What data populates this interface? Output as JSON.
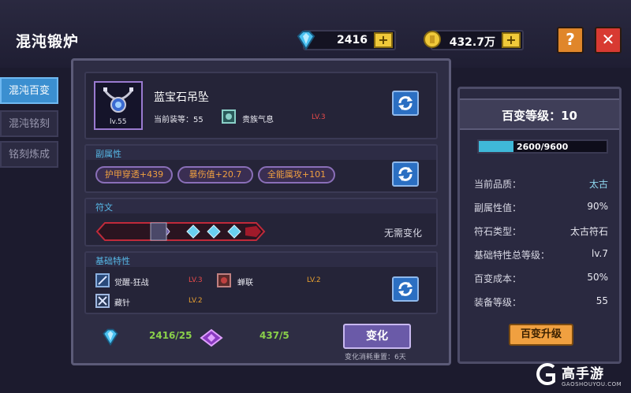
{
  "header": {
    "title": "混沌锻炉",
    "diamonds": "2416",
    "gold": "432.7万",
    "plus_label": "+",
    "help_label": "?",
    "close_label": "✕"
  },
  "tabs": [
    {
      "label": "混沌百变",
      "active": true
    },
    {
      "label": "混沌铭刻",
      "active": false
    },
    {
      "label": "铭刻炼成",
      "active": false
    }
  ],
  "item": {
    "name": "蓝宝石吊坠",
    "level_badge": "lv.55",
    "equip_level_label": "当前装等：55",
    "aura_name": "贵族气息",
    "aura_level": "LV.3"
  },
  "sub_attributes": {
    "title": "副属性",
    "pills": [
      "护甲穿透+439",
      "暴伤值+20.7",
      "全能属攻+101"
    ]
  },
  "rune": {
    "title": "符文",
    "status": "无需变化"
  },
  "base_traits": {
    "title": "基础特性",
    "traits": [
      {
        "name": "觉醒-狂战",
        "level": "LV.3",
        "level_color": "red"
      },
      {
        "name": "蝉联",
        "level": "LV.2",
        "level_color": "orange"
      },
      {
        "name": "藏针",
        "level": "LV.2",
        "level_color": "orange"
      }
    ]
  },
  "costs": {
    "diamond": "2416/25",
    "crystal": "437/5"
  },
  "change_button": "变化",
  "change_note": "变化消耗重置：6天",
  "right_panel": {
    "title": "百变等级：10",
    "xp_text": "2600/9600",
    "xp_fraction": 0.27,
    "stats": [
      {
        "label": "当前品质：",
        "value": "太古",
        "cyan": true
      },
      {
        "label": "副属性值：",
        "value": "90%",
        "cyan": false
      },
      {
        "label": "符石类型：",
        "value": "太古符石",
        "cyan": false
      },
      {
        "label": "基础特性总等级：",
        "value": "lv.7",
        "cyan": false
      },
      {
        "label": "百变成本：",
        "value": "50%",
        "cyan": false
      },
      {
        "label": "装备等级：",
        "value": "55",
        "cyan": false
      }
    ],
    "upgrade_button": "百变升级"
  },
  "watermark": {
    "brand": "高手游",
    "url": "GAOSHOUYOU.COM"
  },
  "colors": {
    "accent_blue": "#3b8fd0",
    "gold": "#f0c93a",
    "section_title": "#57b9e8",
    "pill_text": "#f0a040",
    "level_red": "#e84a4a",
    "level_orange": "#e8a030",
    "xp_fill": "#3fb8d8"
  }
}
